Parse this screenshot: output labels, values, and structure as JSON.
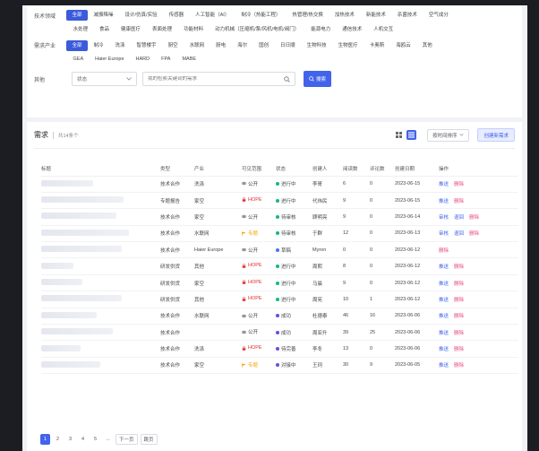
{
  "filters": {
    "tech_field": {
      "label": "技术领域",
      "items": [
        "全部",
        "减振降噪",
        "设计/仿真/实验",
        "传感器",
        "人工智能（AI）",
        "制冷（热能工程）",
        "热管理/热交换",
        "加热技术",
        "新能技术",
        "杀菌技术",
        "空气成分"
      ]
    },
    "tech_field_more": [
      "水处理",
      "食品",
      "健康医疗",
      "表面处理",
      "功能材料",
      "动力机械（压缩机/泵/风机/电机/阀门）",
      "能源电力",
      "通信技术",
      "人机交互"
    ],
    "industry": {
      "label": "需求产业",
      "items": [
        "全部",
        "制冷",
        "洗涤",
        "智慧楼宇",
        "厨空",
        "水联网",
        "厨电",
        "海尔",
        "国创",
        "日日顺",
        "生物科技",
        "生物医疗",
        "卡奥斯",
        "海鸥云",
        "其他"
      ]
    },
    "industry_more": [
      "GEA",
      "Haier Europe",
      "HARD",
      "FPA",
      "MABE"
    ],
    "other": {
      "label": "其他",
      "status_value": "状态",
      "search_placeholder": "我的检索关键词的需求",
      "search_button": "搜索"
    }
  },
  "list": {
    "title": "需求",
    "count": "共14条个",
    "sort_label": "按时间排序",
    "create_button": "创建新需求",
    "columns": [
      "标题",
      "类型",
      "产业",
      "可见范围",
      "状态",
      "创建人",
      "阅读数",
      "评论数",
      "创建日期",
      "操作"
    ],
    "rows": [
      {
        "type": "技术合作",
        "industry": "洗涤",
        "vis": "公开",
        "vis_kind": "pub",
        "status": "进行中",
        "status_color": "#12b886",
        "creator": "李哥",
        "reads": "6",
        "comments": "0",
        "date": "2023-06-15",
        "ops": [
          "推送",
          "删除"
        ]
      },
      {
        "type": "专题报告",
        "industry": "家空",
        "vis": "HOPE",
        "vis_kind": "hope",
        "status": "进行中",
        "status_color": "#12b886",
        "creator": "代伟民",
        "reads": "9",
        "comments": "0",
        "date": "2023-06-15",
        "ops": [
          "推送",
          "删除"
        ]
      },
      {
        "type": "技术合作",
        "industry": "家空",
        "vis": "公开",
        "vis_kind": "pub",
        "status": "待审核",
        "status_color": "#12b886",
        "creator": "顾明亮",
        "reads": "9",
        "comments": "0",
        "date": "2023-06-14",
        "ops": [
          "审核",
          "退回",
          "删除"
        ]
      },
      {
        "type": "技术合作",
        "industry": "水联网",
        "vis": "专题",
        "vis_kind": "soon",
        "status": "待审核",
        "status_color": "#12b886",
        "creator": "于群",
        "reads": "12",
        "comments": "0",
        "date": "2023-06-13",
        "ops": [
          "审核",
          "退回",
          "删除"
        ]
      },
      {
        "type": "技术合作",
        "industry": "Haier Europe",
        "vis": "公开",
        "vis_kind": "pub",
        "status": "草稿",
        "status_color": "#4c6ef5",
        "creator": "Myron",
        "reads": "0",
        "comments": "0",
        "date": "2023-06-12",
        "ops": [
          "删除"
        ]
      },
      {
        "type": "研发供货",
        "industry": "其他",
        "vis": "HOPE",
        "vis_kind": "hope",
        "status": "进行中",
        "status_color": "#12b886",
        "creator": "周熙",
        "reads": "8",
        "comments": "0",
        "date": "2023-06-12",
        "ops": [
          "推送",
          "删除"
        ]
      },
      {
        "type": "研发供货",
        "industry": "家空",
        "vis": "HOPE",
        "vis_kind": "hope",
        "status": "进行中",
        "status_color": "#12b886",
        "creator": "马晨",
        "reads": "9",
        "comments": "0",
        "date": "2023-06-12",
        "ops": [
          "推送",
          "删除"
        ]
      },
      {
        "type": "研发供货",
        "industry": "其他",
        "vis": "HOPE",
        "vis_kind": "hope",
        "status": "进行中",
        "status_color": "#12b886",
        "creator": "周宪",
        "reads": "10",
        "comments": "1",
        "date": "2023-06-12",
        "ops": [
          "推送",
          "删除"
        ]
      },
      {
        "type": "技术合作",
        "industry": "水联网",
        "vis": "公开",
        "vis_kind": "pub",
        "status": "成功",
        "status_color": "#7048e8",
        "creator": "杜德泰",
        "reads": "46",
        "comments": "16",
        "date": "2023-06-06",
        "ops": [
          "推送",
          "删除"
        ]
      },
      {
        "type": "技术合作",
        "industry": "",
        "vis": "公开",
        "vis_kind": "pub",
        "status": "成功",
        "status_color": "#7048e8",
        "creator": "周亚升",
        "reads": "39",
        "comments": "25",
        "date": "2023-06-06",
        "ops": [
          "推送",
          "删除"
        ]
      },
      {
        "type": "技术合作",
        "industry": "洗涤",
        "vis": "HOPE",
        "vis_kind": "hope",
        "status": "待完善",
        "status_color": "#7048e8",
        "creator": "李冬",
        "reads": "13",
        "comments": "0",
        "date": "2023-06-06",
        "ops": [
          "推送",
          "删除"
        ]
      },
      {
        "type": "技术合作",
        "industry": "家空",
        "vis": "专题",
        "vis_kind": "soon",
        "status": "对接中",
        "status_color": "#7048e8",
        "creator": "王珂",
        "reads": "30",
        "comments": "9",
        "date": "2023-06-05",
        "ops": [
          "推送",
          "删除"
        ]
      }
    ]
  },
  "pagination": {
    "pages": [
      "1",
      "2",
      "3",
      "4",
      "5",
      "..."
    ],
    "next_label": "下一页",
    "jump_label": "跳页"
  },
  "colors": {
    "accent": "#4263eb",
    "hope": "#e03131",
    "special": "#f59f00",
    "delete": "#e64980"
  }
}
